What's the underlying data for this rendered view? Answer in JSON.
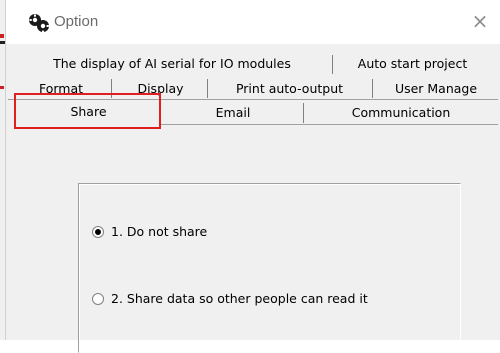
{
  "window": {
    "title": "Option",
    "close_glyph": "×",
    "icon": "app-gear-icon"
  },
  "tabs": {
    "row1": [
      {
        "label": "The display of AI serial for IO modules"
      },
      {
        "label": "Auto start project"
      }
    ],
    "row2": [
      {
        "label": "Format"
      },
      {
        "label": "Display"
      },
      {
        "label": "Print auto-output"
      },
      {
        "label": "User Manage"
      }
    ],
    "row3": [
      {
        "label": "Share",
        "selected": true
      },
      {
        "label": "Email"
      },
      {
        "label": "Communication"
      }
    ]
  },
  "share": {
    "options": [
      {
        "label": "1. Do not share",
        "checked": true
      },
      {
        "label": "2. Share data so other people can read it",
        "checked": false
      }
    ]
  },
  "colors": {
    "highlight": "#e02020",
    "dialog_bg": "#f0f0f0"
  }
}
